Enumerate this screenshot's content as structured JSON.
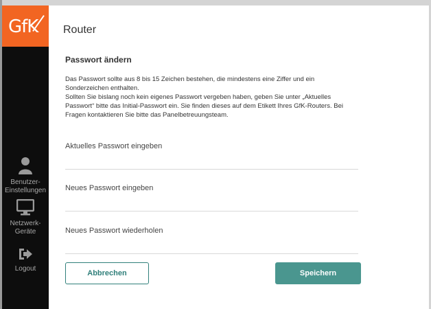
{
  "brand": {
    "logo_text": "GfK",
    "accent_color": "#f26522",
    "button_color": "#4a968f"
  },
  "header": {
    "title": "Router"
  },
  "sidebar": {
    "items": [
      {
        "label": "Benutzer-\nEinstellungen",
        "icon": "user-icon"
      },
      {
        "label": "Netzwerk-\nGeräte",
        "icon": "monitor-icon"
      },
      {
        "label": "Logout",
        "icon": "logout-icon"
      }
    ]
  },
  "main": {
    "section_title": "Passwort ändern",
    "info_line1": "Das Passwort sollte aus 8 bis 15 Zeichen bestehen, die mindestens eine Ziffer und ein",
    "info_line2": "Sonderzeichen enthalten.",
    "info_line3": "Sollten Sie bislang noch kein eigenes Passwort vergeben haben, geben Sie unter „Aktuelles",
    "info_line4": "Passwort“ bitte das Initial-Passwort ein. Sie finden dieses auf dem Etikett Ihres GfK-Routers. Bei",
    "info_line5": "Fragen kontaktieren Sie bitte das Panelbetreuungsteam.",
    "fields": [
      {
        "label": "Aktuelles Passwort eingeben",
        "value": ""
      },
      {
        "label": "Neues Passwort eingeben",
        "value": ""
      },
      {
        "label": "Neues Passwort wiederholen",
        "value": ""
      }
    ],
    "buttons": {
      "cancel_label": "Abbrechen",
      "save_label": "Speichern"
    }
  }
}
